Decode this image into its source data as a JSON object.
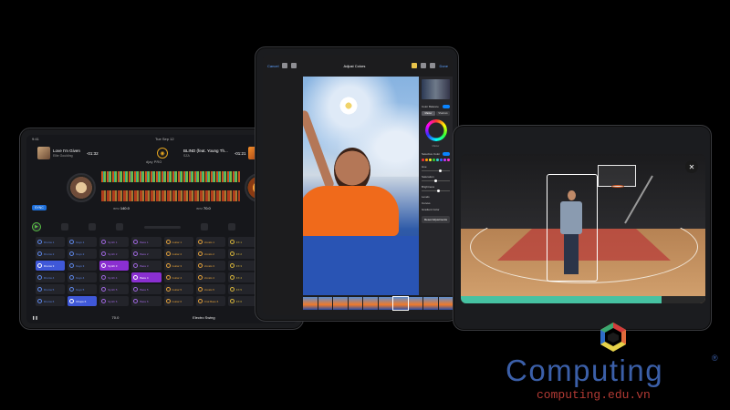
{
  "dj_app": {
    "status_left": "9:41",
    "status_center": "Tue Sep 12",
    "deck_left": {
      "title": "Love I'm Given",
      "artist": "Ellie Goulding",
      "time_elapsed": "-01:32",
      "time_total": "-01:32"
    },
    "deck_right": {
      "title": "BLIND (feat. Young Th...",
      "artist": "SZA",
      "time_elapsed": "-01:21",
      "time_total": "-01:21"
    },
    "brand": "djay PRO",
    "sync_label": "SYNC",
    "bpm_left": "140.0",
    "bpm_right": "70.0",
    "bpm_unit": "BPM",
    "pad_columns": [
      {
        "color": "blue",
        "pads": [
          "Drums 1",
          "Drums 2",
          "Drums 3",
          "Drums 4",
          "Drums 5",
          "Drums 6"
        ],
        "active": [
          2
        ]
      },
      {
        "color": "blue",
        "pads": [
          "Keys 1",
          "Keys 2",
          "Keys 3",
          "Keys 4",
          "Keys 5",
          "Chops 6"
        ],
        "active": [
          5
        ]
      },
      {
        "color": "purple",
        "pads": [
          "Synth 1",
          "Synth 2",
          "Synth 3",
          "Synth 4",
          "Synth 5",
          "Synth 6"
        ],
        "active": [
          2
        ]
      },
      {
        "color": "purple",
        "pads": [
          "Bass 1",
          "Bass 2",
          "Bass 3",
          "Bass 4",
          "Bass 5",
          "Bass 6"
        ],
        "active": [
          3
        ]
      },
      {
        "color": "orange",
        "pads": [
          "Guitar 1",
          "Guitar 2",
          "Guitar 3",
          "Guitar 4",
          "Guitar 5",
          "Guitar 6"
        ],
        "active": []
      },
      {
        "color": "orange",
        "pads": [
          "Vocals 1",
          "Vocals 2",
          "Vocals 3",
          "Vocals 4",
          "Vocals 5",
          "Oral Bass 6"
        ],
        "active": []
      },
      {
        "color": "yellow",
        "pads": [
          "FX 1",
          "FX 2",
          "FX 3",
          "FX 4",
          "FX 5",
          "FX 6"
        ],
        "active": []
      },
      {
        "color": "green",
        "pads": [
          "Hi-hat 1",
          "Hi-hat 2",
          "Hi-hat 3",
          "Hi-hat 4",
          "Hi-hat 5",
          "Hi-hat 6"
        ],
        "active": []
      }
    ],
    "footer_left": "70.0",
    "footer_genre": "Electro Swing"
  },
  "photo_app": {
    "cancel_label": "Cancel",
    "title": "Adjust Colors",
    "done_label": "Done",
    "panel": {
      "color_balance_label": "Color Balance",
      "balance_value": "HSL",
      "seg_left": "Master",
      "seg_right": "Shadows",
      "wheel_label": "Master",
      "selective_color_label": "Selective Color",
      "sliders": [
        "Hue",
        "Saturation",
        "Brightness"
      ],
      "levels_label": "Levels",
      "curves_label": "Curves",
      "gradient_label": "Gradient Color",
      "reset_label": "Reset Adjustments"
    }
  },
  "court_app": {
    "close_icon": "close-icon",
    "progress": 0.82
  },
  "watermark": {
    "name": "Computing",
    "reg": "®",
    "url": "computing.edu.vn"
  },
  "colors": {
    "pad_blue": "#5c86e8",
    "pad_purple": "#a067e0",
    "pad_orange": "#e2a03a",
    "pad_yellow": "#d7b53a",
    "pad_green": "#5fc163",
    "accent_sync": "#1e6fd9",
    "progress_fill": "#46c2a2",
    "watermark_blue": "#3b5fa8",
    "watermark_red": "#b23a34"
  }
}
